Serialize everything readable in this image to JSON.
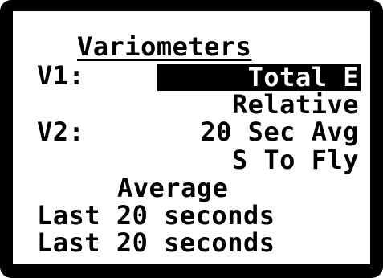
{
  "screen": {
    "title": "Variometers",
    "v1": {
      "label": "V1:",
      "value": "Total E",
      "option2": "Relative"
    },
    "v2": {
      "label": "V2:",
      "value": "20 Sec Avg",
      "option2": "S To Fly"
    },
    "average": {
      "heading": "Average",
      "line1": "Last 20 seconds",
      "line2": "Last 20 seconds"
    }
  },
  "colors": {
    "background": "#ffffff",
    "foreground": "#000000",
    "highlight_bg": "#000000",
    "highlight_fg": "#ffffff"
  }
}
